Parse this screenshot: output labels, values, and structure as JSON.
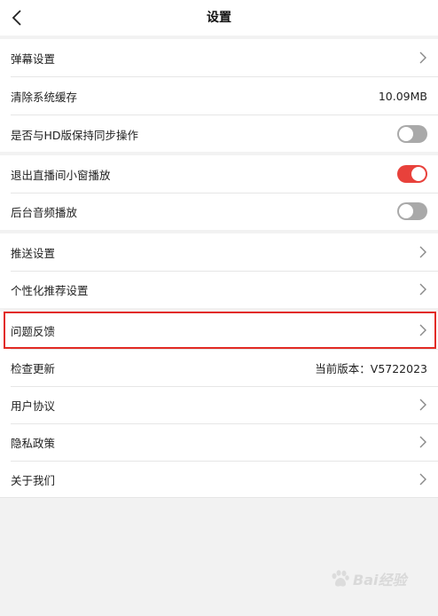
{
  "header": {
    "title": "设置",
    "back_icon": "chevron-left-icon"
  },
  "colors": {
    "accent": "#e8413b",
    "toggle_off": "#a9a9a9",
    "highlight": "#e22b24",
    "background": "#f2f2f2"
  },
  "group1": {
    "danmaku": {
      "label": "弹幕设置"
    },
    "clear_cache": {
      "label": "清除系统缓存",
      "value": "10.09MB"
    },
    "hd_sync": {
      "label": "是否与HD版保持同步操作",
      "toggle": "off"
    }
  },
  "group2": {
    "pip": {
      "label": "退出直播间小窗播放",
      "toggle": "on"
    },
    "bg_audio": {
      "label": "后台音频播放",
      "toggle": "off"
    }
  },
  "group3": {
    "push": {
      "label": "推送设置"
    },
    "personalize": {
      "label": "个性化推荐设置"
    }
  },
  "group4": {
    "feedback": {
      "label": "问题反馈"
    },
    "update": {
      "label": "检查更新",
      "value": "当前版本：V5722023"
    },
    "agreement": {
      "label": "用户协议"
    },
    "privacy": {
      "label": "隐私政策"
    },
    "about": {
      "label": "关于我们"
    }
  },
  "watermark": {
    "text": "Bai经验"
  }
}
